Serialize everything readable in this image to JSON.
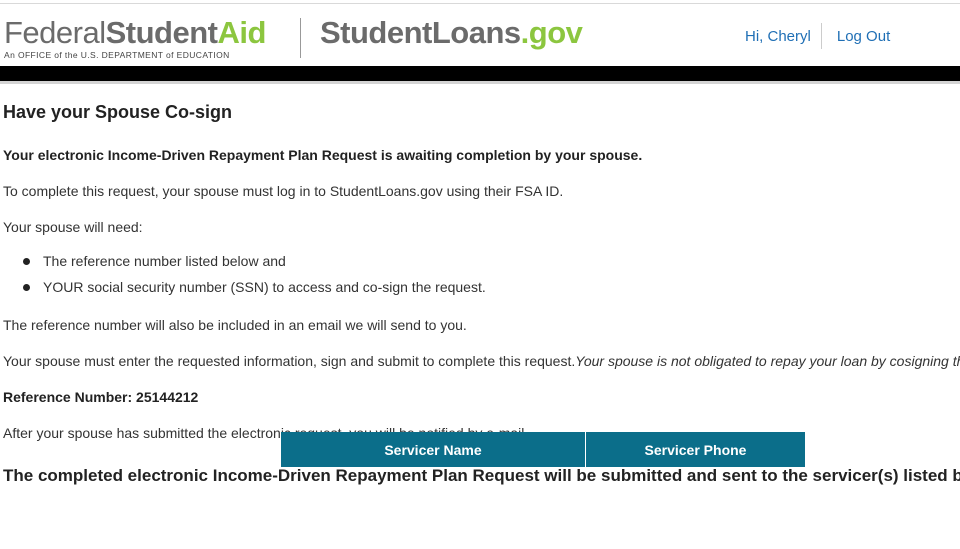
{
  "header": {
    "fsa_logo": {
      "word1": "Federal",
      "word2": "Student",
      "word3": "Aid",
      "tagline": "An OFFICE of the U.S. DEPARTMENT of EDUCATION"
    },
    "sl_logo": {
      "part1": "Student",
      "part2": "Loans",
      "part3": ".gov"
    },
    "greeting": "Hi, Cheryl",
    "logout": "Log Out"
  },
  "content": {
    "title": "Have your Spouse Co-sign",
    "awaiting": "Your electronic Income-Driven Repayment Plan Request is awaiting completion by your spouse.",
    "to_complete": "To complete this request, your spouse must log in to StudentLoans.gov using their FSA ID.",
    "will_need": "Your spouse will need:",
    "needs": [
      "The reference number listed below and",
      "YOUR social security number (SSN) to access and co-sign the request."
    ],
    "email_note": "The reference number will also be included in an email we will send to you.",
    "must_enter": "Your spouse must enter the requested information, sign and submit to complete this request.",
    "not_obligated": "Your spouse is not obligated to repay your loan by cosigning this request.",
    "reference_label": "Reference Number:",
    "reference_number": "25144212",
    "notified": "After your spouse has submitted the electronic request, you will be notified by e-mail.",
    "submitted_heading": "The completed electronic Income-Driven Repayment Plan Request will be submitted and sent to the servicer(s) listed below.",
    "table_headers": [
      "Servicer Name",
      "Servicer Phone"
    ]
  },
  "colors": {
    "brand_green": "#8cc63f",
    "brand_grey": "#6b6b6b",
    "link_blue": "#1f6fb5",
    "table_header_teal": "#0b6e8a"
  }
}
